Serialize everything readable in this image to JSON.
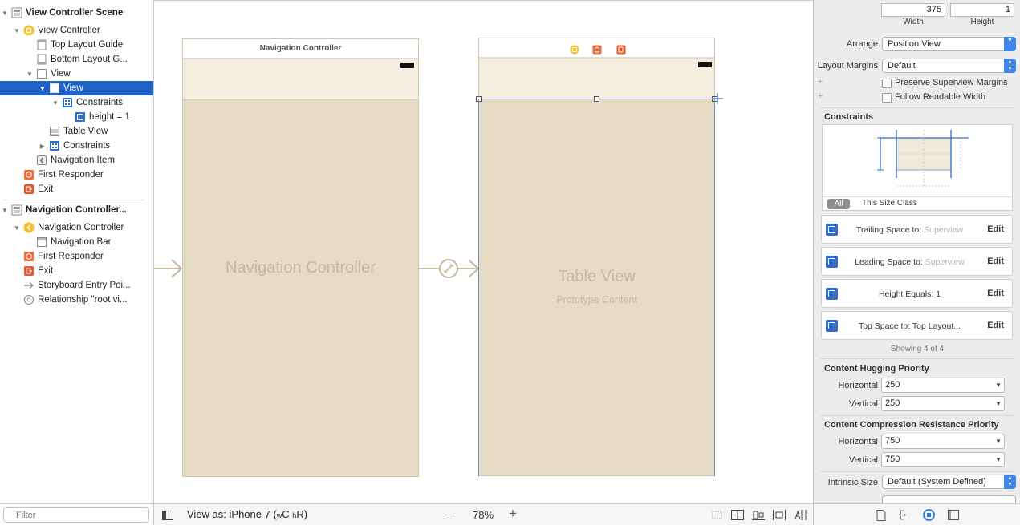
{
  "outline": {
    "items": [
      {
        "label": "View Controller Scene",
        "bold": true
      },
      {
        "label": "View Controller"
      },
      {
        "label": "Top Layout Guide"
      },
      {
        "label": "Bottom Layout G..."
      },
      {
        "label": "View"
      },
      {
        "label": "View"
      },
      {
        "label": "Constraints"
      },
      {
        "label": "height = 1"
      },
      {
        "label": "Table View"
      },
      {
        "label": "Constraints"
      },
      {
        "label": "Navigation Item"
      },
      {
        "label": "First Responder"
      },
      {
        "label": "Exit"
      },
      {
        "label": "Navigation Controller...",
        "bold": true
      },
      {
        "label": "Navigation Controller"
      },
      {
        "label": "Navigation Bar"
      },
      {
        "label": "First Responder"
      },
      {
        "label": "Exit"
      },
      {
        "label": "Storyboard Entry Poi..."
      },
      {
        "label": "Relationship \"root vi..."
      }
    ],
    "filter_placeholder": "Filter"
  },
  "canvas": {
    "nav_scene": {
      "title": "Navigation Controller",
      "center_label": "Navigation Controller"
    },
    "table_scene": {
      "title_label": "Table View",
      "subtitle": "Prototype Content"
    }
  },
  "bottombar": {
    "view_as_prefix": "View as: iPhone 7 (",
    "size_w": "w",
    "size_c": "C",
    "size_h": "h",
    "size_r": "R",
    "view_as_suffix": ")",
    "zoom_minus": "—",
    "zoom": "78%",
    "zoom_plus": "+"
  },
  "inspector": {
    "width_value": "375",
    "height_value": "1",
    "width_label": "Width",
    "height_label": "Height",
    "arrange_label": "Arrange",
    "arrange_value": "Position View",
    "layout_margins_label": "Layout Margins",
    "layout_margins_value": "Default",
    "preserve_label": "Preserve Superview Margins",
    "readable_label": "Follow Readable Width",
    "constraints_header": "Constraints",
    "seg_all": "All",
    "seg_size_class": "This Size Class",
    "constraints": [
      {
        "label": "Trailing Space to:",
        "target": "Superview",
        "muted": true,
        "edit": "Edit"
      },
      {
        "label": "Leading Space to:",
        "target": "Superview",
        "muted": true,
        "edit": "Edit"
      },
      {
        "label": "Height Equals:",
        "target": "1",
        "muted": false,
        "edit": "Edit"
      },
      {
        "label": "Top Space to:",
        "target": "Top Layout...",
        "muted": false,
        "edit": "Edit"
      }
    ],
    "showing": "Showing 4 of 4",
    "hugging_header": "Content Hugging Priority",
    "horizontal_label": "Horizontal",
    "vertical_label": "Vertical",
    "hug_h": "250",
    "hug_v": "250",
    "compression_header": "Content Compression Resistance Priority",
    "comp_h": "750",
    "comp_v": "750",
    "intrinsic_label": "Intrinsic Size",
    "intrinsic_value": "Default (System Defined)"
  },
  "colors": {
    "selection": "#1f63c6",
    "device_fill": "#e6dcc6",
    "navbar_fill": "#f4eee0",
    "accent_blue": "#3d86f0"
  }
}
